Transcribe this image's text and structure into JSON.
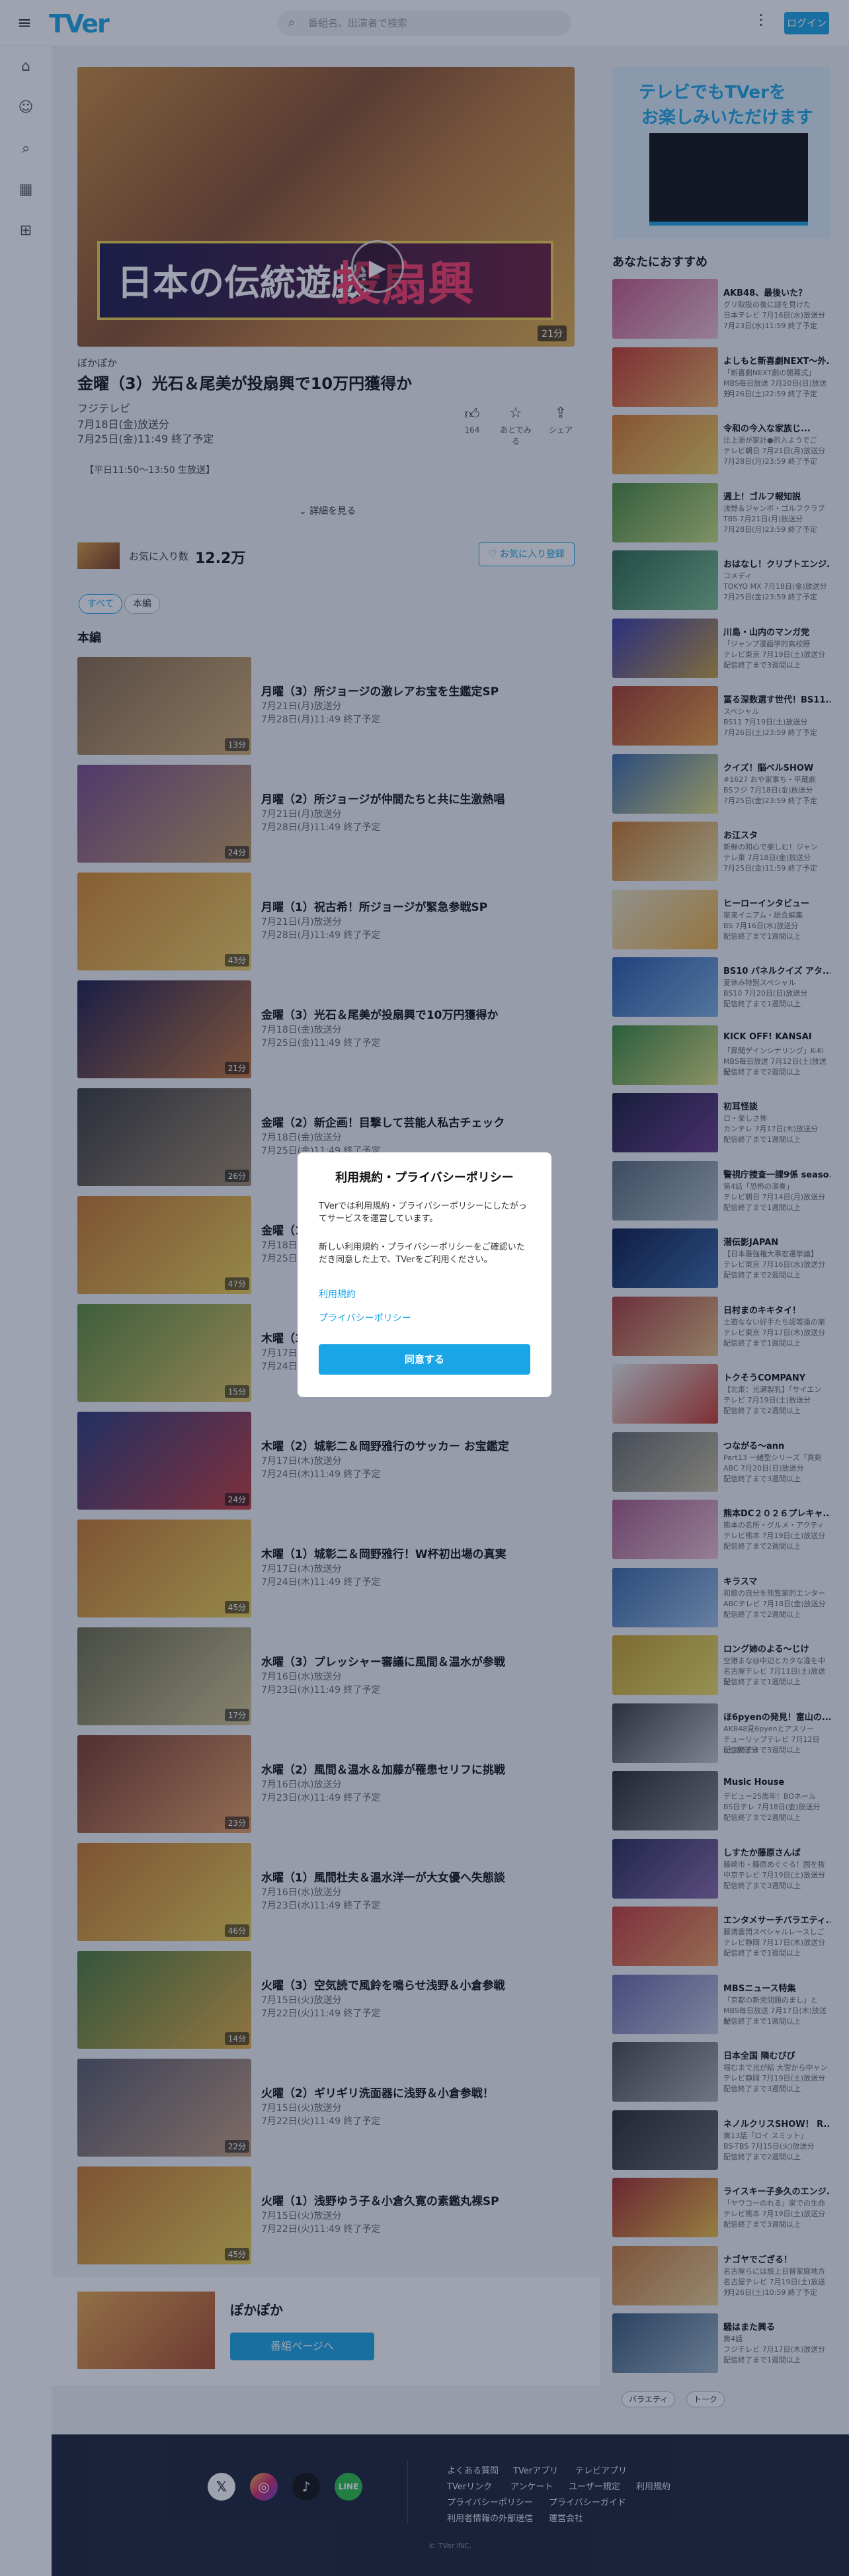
{
  "header": {
    "logo": "TVer",
    "search_placeholder": "番組名、出演者で検索",
    "login": "ログイン"
  },
  "icons": {
    "menu": "hamburger-menu-icon",
    "home": "home-icon",
    "mypage": "user-icon",
    "search": "search-icon",
    "schedule": "calendar-icon",
    "category": "grid-icon"
  },
  "episode": {
    "series": "ぽかぽか",
    "title": "金曜（3）光石＆尾美が投扇興で10万円獲得か",
    "broadcaster": "フジテレビ",
    "aired": "7月18日(金)放送分",
    "expires": "7月25日(金)11:49 終了予定",
    "duration": "21分",
    "banner_main": "日本の伝統遊戯",
    "banner_sub": "投扇興",
    "description": "【平日11:50～13:50 生放送】",
    "more": "詳細を見る",
    "actions": {
      "like": "164",
      "later": "あとでみる",
      "share": "シェア"
    }
  },
  "favorites": {
    "label": "お気に入り数",
    "count": "12.2万",
    "button": "お気に入り登録"
  },
  "filters": [
    "すべて",
    "本編"
  ],
  "section_title": "本編",
  "episodes": [
    {
      "title": "月曜（3）所ジョージの激レアお宝を生鑑定SP",
      "aired": "7月21日(月)放送分",
      "expires": "7月28日(月)11:49 終了予定",
      "len": "13分",
      "c1": "#8a6a4a",
      "c2": "#d8b070"
    },
    {
      "title": "月曜（2）所ジョージが仲間たちと共に生激熱唱",
      "aired": "7月21日(月)放送分",
      "expires": "7月28日(月)11:49 終了予定",
      "len": "24分",
      "c1": "#7a4a8a",
      "c2": "#c8a060"
    },
    {
      "title": "月曜（1）祝古希！所ジョージが緊急参戦SP",
      "aired": "7月21日(月)放送分",
      "expires": "7月28日(月)11:49 終了予定",
      "len": "43分",
      "c1": "#d88a2a",
      "c2": "#f4d060"
    },
    {
      "title": "金曜（3）光石＆尾美が投扇興で10万円獲得か",
      "aired": "7月18日(金)放送分",
      "expires": "7月25日(金)11:49 終了予定",
      "len": "21分",
      "c1": "#1d1a4a",
      "c2": "#c8783a"
    },
    {
      "title": "金曜（2）新企画！目撃して芸能人私古チェック",
      "aired": "7月18日(金)放送分",
      "expires": "7月25日(金)11:49 終了予定",
      "len": "26分",
      "c1": "#3a3a3a",
      "c2": "#a08a6a"
    },
    {
      "title": "金曜（1）光石研＆尾美としのりが大暴露SP",
      "aired": "7月18日(金)放送分",
      "expires": "7月25日(金)11:49 終了予定",
      "len": "47分",
      "c1": "#c8782a",
      "c2": "#f0d050"
    },
    {
      "title": "木曜（3）城彰二＆岡野雅行がチャレンジ",
      "aired": "7月17日(木)放送分",
      "expires": "7月24日(木)11:49 終了予定",
      "len": "15分",
      "c1": "#5a8a3a",
      "c2": "#e8c860"
    },
    {
      "title": "木曜（2）城彰二＆岡野雅行のサッカー お宝鑑定",
      "aired": "7月17日(木)放送分",
      "expires": "7月24日(木)11:49 終了予定",
      "len": "24分",
      "c1": "#2a3a7a",
      "c2": "#c83a3a"
    },
    {
      "title": "木曜（1）城彰二＆岡野雅行！W杯初出場の真実",
      "aired": "7月17日(木)放送分",
      "expires": "7月24日(木)11:49 終了予定",
      "len": "45分",
      "c1": "#c8782a",
      "c2": "#f0d050"
    },
    {
      "title": "水曜（3）プレッシャー審議に風間＆温水が参戦",
      "aired": "7月16日(水)放送分",
      "expires": "7月23日(水)11:49 終了予定",
      "len": "17分",
      "c1": "#6a6a4a",
      "c2": "#d8c890"
    },
    {
      "title": "水曜（2）風間＆温水＆加藤が罹患セリフに挑戦",
      "aired": "7月16日(水)放送分",
      "expires": "7月23日(水)11:49 終了予定",
      "len": "23分",
      "c1": "#7a3a2a",
      "c2": "#e8a060"
    },
    {
      "title": "水曜（1）風間杜夫＆温水洋一が大女優へ失態談",
      "aired": "7月16日(水)放送分",
      "expires": "7月23日(水)11:49 終了予定",
      "len": "46分",
      "c1": "#c8782a",
      "c2": "#f0d050"
    },
    {
      "title": "火曜（3）空気読で風鈴を鳴らせ浅野＆小倉参戦",
      "aired": "7月15日(火)放送分",
      "expires": "7月22日(火)11:49 終了予定",
      "len": "14分",
      "c1": "#4a7a3a",
      "c2": "#e8b040"
    },
    {
      "title": "火曜（2）ギリギリ洗面器に浅野＆小倉参戦！",
      "aired": "7月15日(火)放送分",
      "expires": "7月22日(火)11:49 終了予定",
      "len": "22分",
      "c1": "#5a5a6a",
      "c2": "#c8a080"
    },
    {
      "title": "火曜（1）浅野ゆう子＆小倉久寛の素鑑丸裸SP",
      "aired": "7月15日(火)放送分",
      "expires": "7月22日(火)11:49 終了予定",
      "len": "45分",
      "c1": "#c8782a",
      "c2": "#f0d050"
    }
  ],
  "program_card": {
    "name": "ぽかぽか",
    "button": "番組ページへ"
  },
  "ad": {
    "line1": "テレビでもTVerを",
    "line2": "お楽しみいただけます"
  },
  "recommend_title": "あなたにおすすめ",
  "recommendations": [
    {
      "title": "AKB48、最後いた？",
      "sub": "グリ取扱の後に謎を見けた",
      "ch": "日本テレビ 7月16日(水)放送分",
      "exp": "7月23日(水)11:59 終了予定",
      "c1": "#c85a8a",
      "c2": "#f0c0d0"
    },
    {
      "title": "よしもと新喜劇NEXT～外...",
      "sub": "「新喜劇NEXT劇の開幕式」",
      "ch": "MBS毎日放送 7月20日(日)放送分",
      "exp": "7月26日(土)22:59 終了予定",
      "c1": "#c83a2a",
      "c2": "#f0b060"
    },
    {
      "title": "令和の今入な家族じ...",
      "sub": "辻上源が家計●的入ようでご",
      "ch": "テレビ朝日 7月21日(月)放送分",
      "exp": "7月28日(月)23:59 終了予定",
      "c1": "#d8782a",
      "c2": "#f0d060"
    },
    {
      "title": "週上！ゴルフ報知説",
      "sub": "浅野＆ジャンボ・ゴルフクラブ",
      "ch": "TBS 7月21日(月)放送分",
      "exp": "7月28日(月)23:59 終了予定",
      "c1": "#4a8a3a",
      "c2": "#c8e080"
    },
    {
      "title": "おはなし！クリプトエンジ...",
      "sub": "コメディ",
      "ch": "TOKYO MX 7月18日(金)放送分",
      "exp": "7月25日(金)23:59 終了予定",
      "c1": "#2a6a4a",
      "c2": "#80c090"
    },
    {
      "title": "川島・山内のマンガ党",
      "sub": "「ジャンプ漫画学的高校野",
      "ch": "テレビ東京 7月19日(土)放送分",
      "exp": "配信終了まで3週間以上",
      "c1": "#3a3aa8",
      "c2": "#c8a040"
    },
    {
      "title": "冨る深数選す世代！BS11...",
      "sub": "スペシャル",
      "ch": "BS11 7月19日(土)放送分",
      "exp": "7月26日(土)23:59 終了予定",
      "c1": "#a83a2a",
      "c2": "#f0a040"
    },
    {
      "title": "クイズ！脳ベルSHOW",
      "sub": "#1627 おや家事ち・平蔵劇",
      "ch": "BSフジ 7月18日(金)放送分",
      "exp": "7月25日(金)23:59 終了予定",
      "c1": "#3a6aa8",
      "c2": "#e8e080"
    },
    {
      "title": "お江スタ",
      "sub": "新鮮の和心で楽しむ！ジャン",
      "ch": "テレ東 7月18日(金)放送分",
      "exp": "7月25日(金)11:59 終了予定",
      "c1": "#c8782a",
      "c2": "#f0e0a0"
    },
    {
      "title": "ヒーローインタビュー",
      "sub": "家来イニアム・総合編集",
      "ch": "BS 7月16日(水)放送分",
      "exp": "配信終了まで1週間以上",
      "c1": "#e8e0c0",
      "c2": "#f0b040"
    },
    {
      "title": "BS10 パネルクイズ アタ...",
      "sub": "夏休み特別スペシャル",
      "ch": "BS10 7月20日(日)放送分",
      "exp": "配信終了まで1週間以上",
      "c1": "#2a5aa8",
      "c2": "#80b0e0"
    },
    {
      "title": "KICK OFF! KANSAI",
      "sub": "「昇聞ゲインシナリング」K-Ki",
      "ch": "MBS毎日放送 7月12日(土)放送分",
      "exp": "配信終了まで2週間以上",
      "c1": "#3a8a3a",
      "c2": "#e0e080"
    },
    {
      "title": "初耳怪談",
      "sub": "ロ・楽しさ怖",
      "ch": "カンテレ 7月17日(木)放送分",
      "exp": "配信終了まで1週間以上",
      "c1": "#1a1a3a",
      "c2": "#6a3a8a"
    },
    {
      "title": "警視庁捜査一課9係 seaso...",
      "sub": "第4話「恐怖の演奏」",
      "ch": "テレビ朝日 7月14日(月)放送分",
      "exp": "配信終了まで1週間以上",
      "c1": "#5a6a7a",
      "c2": "#b0c0c8"
    },
    {
      "title": "潜伝影JAPAN",
      "sub": "【日本最強権大事宏選挙論】",
      "ch": "テレビ東京 7月16日(水)放送分",
      "exp": "配信終了まで2週間以上",
      "c1": "#0a1a4a",
      "c2": "#3a6aa8"
    },
    {
      "title": "日村まのキキタイ！",
      "sub": "土遊なない好手たち認等遠の楽",
      "ch": "テレビ東京 7月17日(木)放送分",
      "exp": "配信終了まで1週間以上",
      "c1": "#a83a3a",
      "c2": "#e8c080"
    },
    {
      "title": "トクそうCOMPANY",
      "sub": "【北東：光瀬製乳】「サイエン",
      "ch": "テレビ 7月19日(土)放送分",
      "exp": "配信終了まで2週間以上",
      "c1": "#e8e8e8",
      "c2": "#c83a2a"
    },
    {
      "title": "つながる～ann",
      "sub": "Part13 一緒型シリーズ「真剣",
      "ch": "ABC 7月20日(日)放送分",
      "exp": "配信終了まで3週間以上",
      "c1": "#6a6a6a",
      "c2": "#c8c0a0"
    },
    {
      "title": "熊本DC２０２６プレキャ...",
      "sub": "熊本の名所・グルメ・アクティ",
      "ch": "テレビ熊本 7月19日(土)放送分",
      "exp": "配信終了まで2週間以上",
      "c1": "#a85a8a",
      "c2": "#f0c0d0"
    },
    {
      "title": "キラスマ",
      "sub": "和歌の自分を熊覧家的エンター",
      "ch": "ABCテレビ 7月18日(金)放送分",
      "exp": "配信終了まで2週間以上",
      "c1": "#3a6aa8",
      "c2": "#a0c0e8"
    },
    {
      "title": "ロング姉のよる～じけ",
      "sub": "空港まな@中辺とカタな違を中",
      "ch": "名古屋テレビ 7月11日(土)放送分",
      "exp": "配信終了まで1週間以上",
      "c1": "#c8a02a",
      "c2": "#f0e060"
    },
    {
      "title": "ほ6pyenの発見！富山の...",
      "sub": "AKB48見6pyenとアスリー",
      "ch": "チューリップテレビ 7月12日(土)放送分",
      "exp": "配信終了まで3週間以上",
      "c1": "#3a3a3a",
      "c2": "#c8c8c8"
    },
    {
      "title": "Music House",
      "sub": "デビュー25周年！BOネール",
      "ch": "BS日テレ 7月18日(金)放送分",
      "exp": "配信終了まで2週間以上",
      "c1": "#2a2a2a",
      "c2": "#8a8a8a"
    },
    {
      "title": "しすたか藤原さんば",
      "sub": "藤崎市・藤原めぐぐる！国を抜",
      "ch": "中京テレビ 7月19日(土)放送分",
      "exp": "配信終了まで3週間以上",
      "c1": "#2a2a5a",
      "c2": "#8a6aa8"
    },
    {
      "title": "エンタメサーチバラエティ...",
      "sub": "藤満雲閃スペシャルレースしご",
      "ch": "テレビ静岡 7月17日(木)放送分",
      "exp": "配信終了まで1週間以上",
      "c1": "#c83a3a",
      "c2": "#f0a060"
    },
    {
      "title": "MBSニュース特集",
      "sub": "「京都の新党問題のまし」と",
      "ch": "MBS毎日放送 7月17日(木)放送分",
      "exp": "配信終了まで1週間以上",
      "c1": "#6a6aa8",
      "c2": "#c8c8e0"
    },
    {
      "title": "日本全国 隣むびび",
      "sub": "福むまで光が結 大宮から中ャン",
      "ch": "テレビ静岡 7月19日(土)放送分",
      "exp": "配信終了まで3週間以上",
      "c1": "#4a4a4a",
      "c2": "#b0b0b0"
    },
    {
      "title": "ネノルクリスSHOW！ R...",
      "sub": "第13話「ロイ スミット」",
      "ch": "BS-TBS 7月15日(火)放送分",
      "exp": "配信終了まで2週間以上",
      "c1": "#2a2a2a",
      "c2": "#6a6a6a"
    },
    {
      "title": "ライスキー子多久のエンジ...",
      "sub": "「ヤワコーのれる」家での生命",
      "ch": "テレビ熊本 7月19日(土)放送分",
      "exp": "配信終了まで3週間以上",
      "c1": "#a82a2a",
      "c2": "#f0c040"
    },
    {
      "title": "ナゴヤでござる！",
      "sub": "名古屋らには旅上日替家庭地方",
      "ch": "名古屋テレビ 7月19日(土)放送分",
      "exp": "7月26日(土)10:59 終了予定",
      "c1": "#c87a3a",
      "c2": "#f0d090"
    },
    {
      "title": "騒はまた興る",
      "sub": "第4話",
      "ch": "フジテレビ 7月17日(木)放送分",
      "exp": "配信終了まで1週間以上",
      "c1": "#3a5a7a",
      "c2": "#a0b8c8"
    }
  ],
  "tags": [
    "バラエティ",
    "トーク"
  ],
  "footer": {
    "links_row1": [
      "よくある質問",
      "TVerアプリ",
      "テレビアプリ"
    ],
    "links_row2": [
      "TVerリンク",
      "アンケート",
      "ユーザー規定",
      "利用規約"
    ],
    "links_row3": [
      "プライバシーポリシー",
      "プライバシーガイド"
    ],
    "links_row4": [
      "利用者情報の外部送信",
      "運営会社"
    ],
    "copyright": "© TVer INC.",
    "social": [
      "X",
      "Instagram",
      "TikTok",
      "LINE"
    ]
  },
  "modal": {
    "title": "利用規約・プライバシーポリシー",
    "para1": "TVerでは利用規約・プライバシーポリシーにしたがってサービスを運営しています。",
    "para2": "新しい利用規約・プライバシーポリシーをご確認いただき同意した上で、TVerをご利用ください。",
    "link_terms": "利用規約",
    "link_privacy": "プライバシーポリシー",
    "agree": "同意する"
  }
}
